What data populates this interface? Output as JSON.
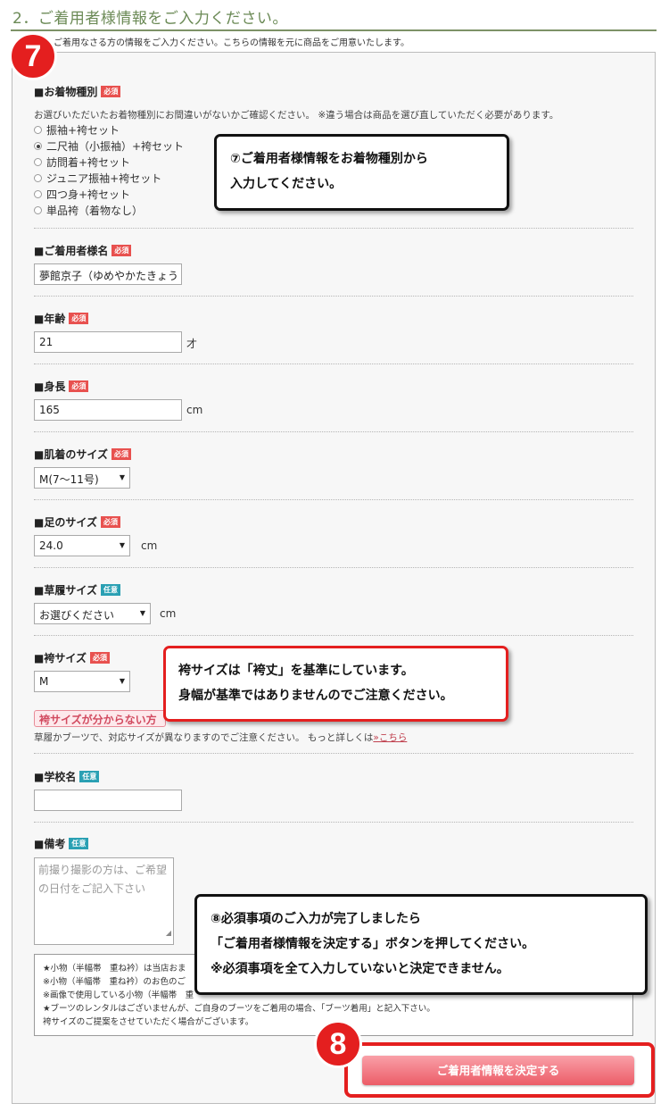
{
  "header": {
    "title": "2．ご着用者様情報をご入力ください。",
    "intro": "ご着用なさる方の情報をご入力ください。こちらの情報を元に商品をご用意いたします。"
  },
  "badges": {
    "required": "必須",
    "optional": "任意"
  },
  "kimono": {
    "label": "■お着物種別",
    "note": "お選びいただいたお着物種別にお間違いがないかご確認ください。 ※違う場合は商品を選び直していただく必要があります。",
    "options": [
      "振袖+袴セット",
      "二尺袖（小振袖）+袴セット",
      "訪問着+袴セット",
      "ジュニア振袖+袴セット",
      "四つ身+袴セット",
      "単品袴（着物なし）"
    ],
    "selected_index": 1
  },
  "name": {
    "label": "■ご着用者様名",
    "value": "夢館京子（ゆめやかたきょう"
  },
  "age": {
    "label": "■年齢",
    "value": "21",
    "unit": "才"
  },
  "height": {
    "label": "■身長",
    "value": "165",
    "unit": "cm"
  },
  "underwear": {
    "label": "■肌着のサイズ",
    "value": "M(7〜11号)"
  },
  "foot": {
    "label": "■足のサイズ",
    "value": "24.0",
    "unit": "cm"
  },
  "zori": {
    "label": "■草履サイズ",
    "value": "お選びください",
    "unit": "cm"
  },
  "hakama": {
    "label": "■袴サイズ",
    "value": "M",
    "help_button": "袴サイズが分からない方",
    "note": "草履かブーツで、対応サイズが異なりますのでご注意ください。 もっと詳しくは",
    "link": "»こちら"
  },
  "school": {
    "label": "■学校名",
    "value": ""
  },
  "remarks": {
    "label": "■備考",
    "placeholder": "前撮り撮影の方は、ご希望\nの日付をご記入下さい"
  },
  "infobox": {
    "lines": [
      "★小物（半幅帯　重ね衿）は当店おま",
      "※小物（半幅帯　重ね衿）のお色のご",
      "※画像で使用している小物（半幅帯　重",
      "★ブーツのレンタルはございませんが、ご自身のブーツをご着用の場合、「ブーツ着用」と記入下さい。",
      "袴サイズのご提案をさせていただく場合がございます。"
    ]
  },
  "submit": {
    "label": "ご着用者情報を決定する"
  },
  "steps": {
    "seven": "7",
    "eight": "8"
  },
  "callouts": {
    "c7": [
      "⑦ご着用者様情報をお着物種別から",
      "入力してください。"
    ],
    "hakama": [
      "袴サイズは「袴丈」を基準にしています。",
      "身幅が基準ではありませんのでご注意ください。"
    ],
    "c8": [
      "⑧必須事項のご入力が完了しましたら",
      "「ご着用者様情報を決定する」ボタンを押してください。",
      "※必須事項を全て入力していないと決定できません。"
    ]
  },
  "colors": {
    "accent": "#e41f1f",
    "title": "#6b8a56",
    "required": "#e8514f",
    "optional": "#2aa0b3"
  }
}
